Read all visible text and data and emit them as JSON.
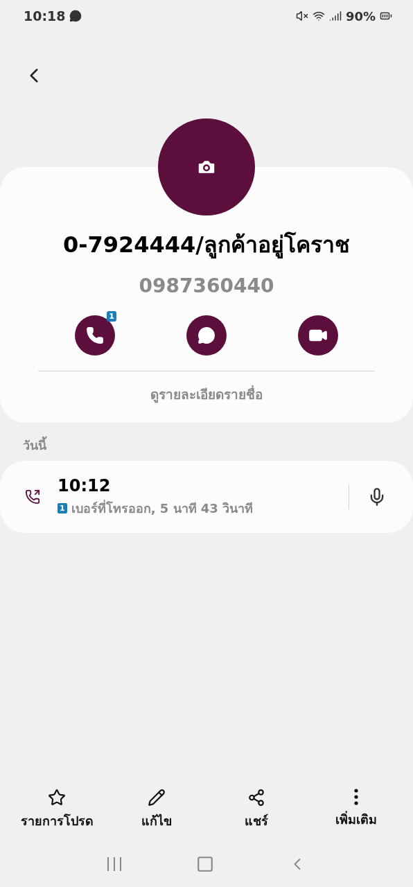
{
  "status_bar": {
    "time": "10:18",
    "battery": "90%"
  },
  "contact": {
    "name": "0-7924444/ลูกค้าอยู่โคราช",
    "number": "0987360440",
    "actions": [
      {
        "kind": "call",
        "sim_badge": "1"
      },
      {
        "kind": "message"
      },
      {
        "kind": "video"
      }
    ],
    "details_link": "ดูรายละเอียดรายชื่อ"
  },
  "history": {
    "section": "วันนี้",
    "entries": [
      {
        "kind": "outgoing",
        "time": "10:12",
        "sim_badge": "1",
        "description": "เบอร์ที่โทรออก, 5 นาที 43 วินาที"
      }
    ]
  },
  "bottom_actions": [
    {
      "kind": "favorite",
      "label": "รายการโปรด"
    },
    {
      "kind": "edit",
      "label": "แก้ไข"
    },
    {
      "kind": "share",
      "label": "แชร์"
    },
    {
      "kind": "more",
      "label": "เพิ่มเติม"
    }
  ]
}
